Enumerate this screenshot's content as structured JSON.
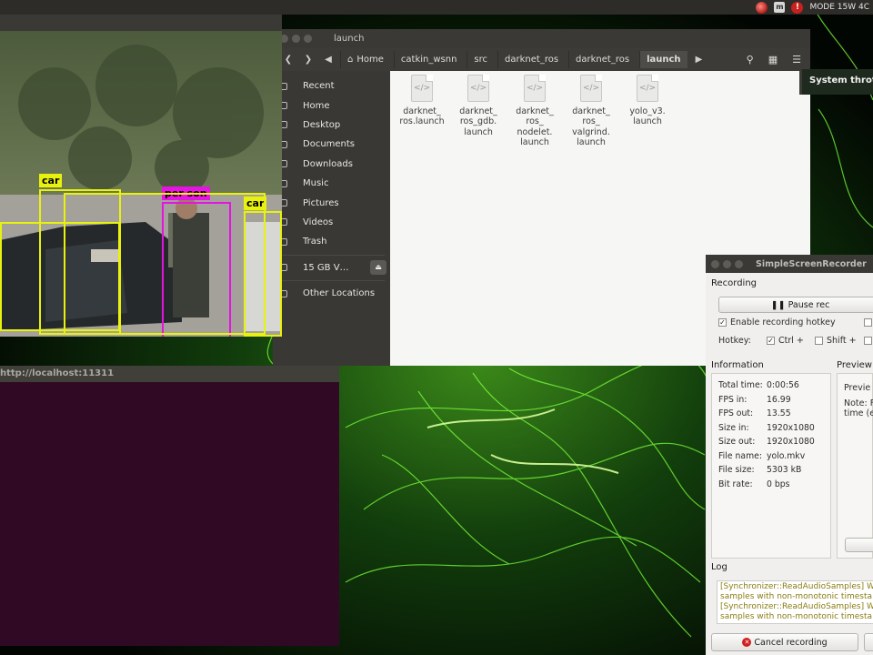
{
  "top_panel": {
    "mode_text": "MODE 15W 4C"
  },
  "file_manager": {
    "title": "launch",
    "breadcrumbs": [
      "Home",
      "catkin_wsnn",
      "src",
      "darknet_ros",
      "darknet_ros",
      "launch"
    ],
    "sidebar": [
      {
        "label": "Recent",
        "icon": "clock-icon"
      },
      {
        "label": "Home",
        "icon": "home-icon"
      },
      {
        "label": "Desktop",
        "icon": "desktop-icon"
      },
      {
        "label": "Documents",
        "icon": "documents-icon"
      },
      {
        "label": "Downloads",
        "icon": "downloads-icon"
      },
      {
        "label": "Music",
        "icon": "music-icon"
      },
      {
        "label": "Pictures",
        "icon": "pictures-icon"
      },
      {
        "label": "Videos",
        "icon": "videos-icon"
      },
      {
        "label": "Trash",
        "icon": "trash-icon"
      },
      {
        "label": "15 GB V…",
        "icon": "drive-icon"
      },
      {
        "label": "Other Locations",
        "icon": "plus-icon"
      }
    ],
    "files": [
      {
        "lines": [
          "darknet_",
          "ros.launch"
        ]
      },
      {
        "lines": [
          "darknet_",
          "ros_gdb.",
          "launch"
        ]
      },
      {
        "lines": [
          "darknet_",
          "ros_",
          "nodelet.",
          "launch"
        ]
      },
      {
        "lines": [
          "darknet_",
          "ros_",
          "valgrind.",
          "launch"
        ]
      },
      {
        "lines": [
          "yolo_v3.",
          "launch"
        ]
      }
    ]
  },
  "notification": {
    "text": "System throt"
  },
  "video": {
    "detections": [
      {
        "label": "car",
        "color": "#e8f20c"
      },
      {
        "label": "per son",
        "color": "#e514e0"
      },
      {
        "label": "car",
        "color": "#e8f20c"
      }
    ]
  },
  "terminal": {
    "title": "http://localhost:11311"
  },
  "recorder": {
    "title": "SimpleScreenRecorder",
    "recording_label": "Recording",
    "pause_label": "Pause rec",
    "enable_hotkey_label": "Enable recording hotkey",
    "hotkey_label": "Hotkey:",
    "ctrl_label": "Ctrl +",
    "shift_label": "Shift +",
    "information_label": "Information",
    "preview_label": "Preview",
    "preview_text": "Previe",
    "note_text_1": "Note: F",
    "note_text_2": "time (e",
    "info": [
      {
        "key": "Total time:",
        "value": "0:00:56"
      },
      {
        "key": "FPS in:",
        "value": "16.99"
      },
      {
        "key": "FPS out:",
        "value": "13.55"
      },
      {
        "key": "Size in:",
        "value": "1920x1080"
      },
      {
        "key": "Size out:",
        "value": "1920x1080"
      },
      {
        "key": "File name:",
        "value": "yolo.mkv"
      },
      {
        "key": "File size:",
        "value": "5303 kB"
      },
      {
        "key": "Bit rate:",
        "value": "0 bps"
      }
    ],
    "log_label": "Log",
    "log_lines": [
      "[Synchronizer::ReadAudioSamples] W",
      "samples with non-monotonic timesta",
      "[Synchronizer::ReadAudioSamples] W",
      "samples with non-monotonic timesta"
    ],
    "cancel_label": "Cancel recording",
    "enable_hotkey_checked": true,
    "ctrl_checked": true,
    "shift_checked": false
  }
}
